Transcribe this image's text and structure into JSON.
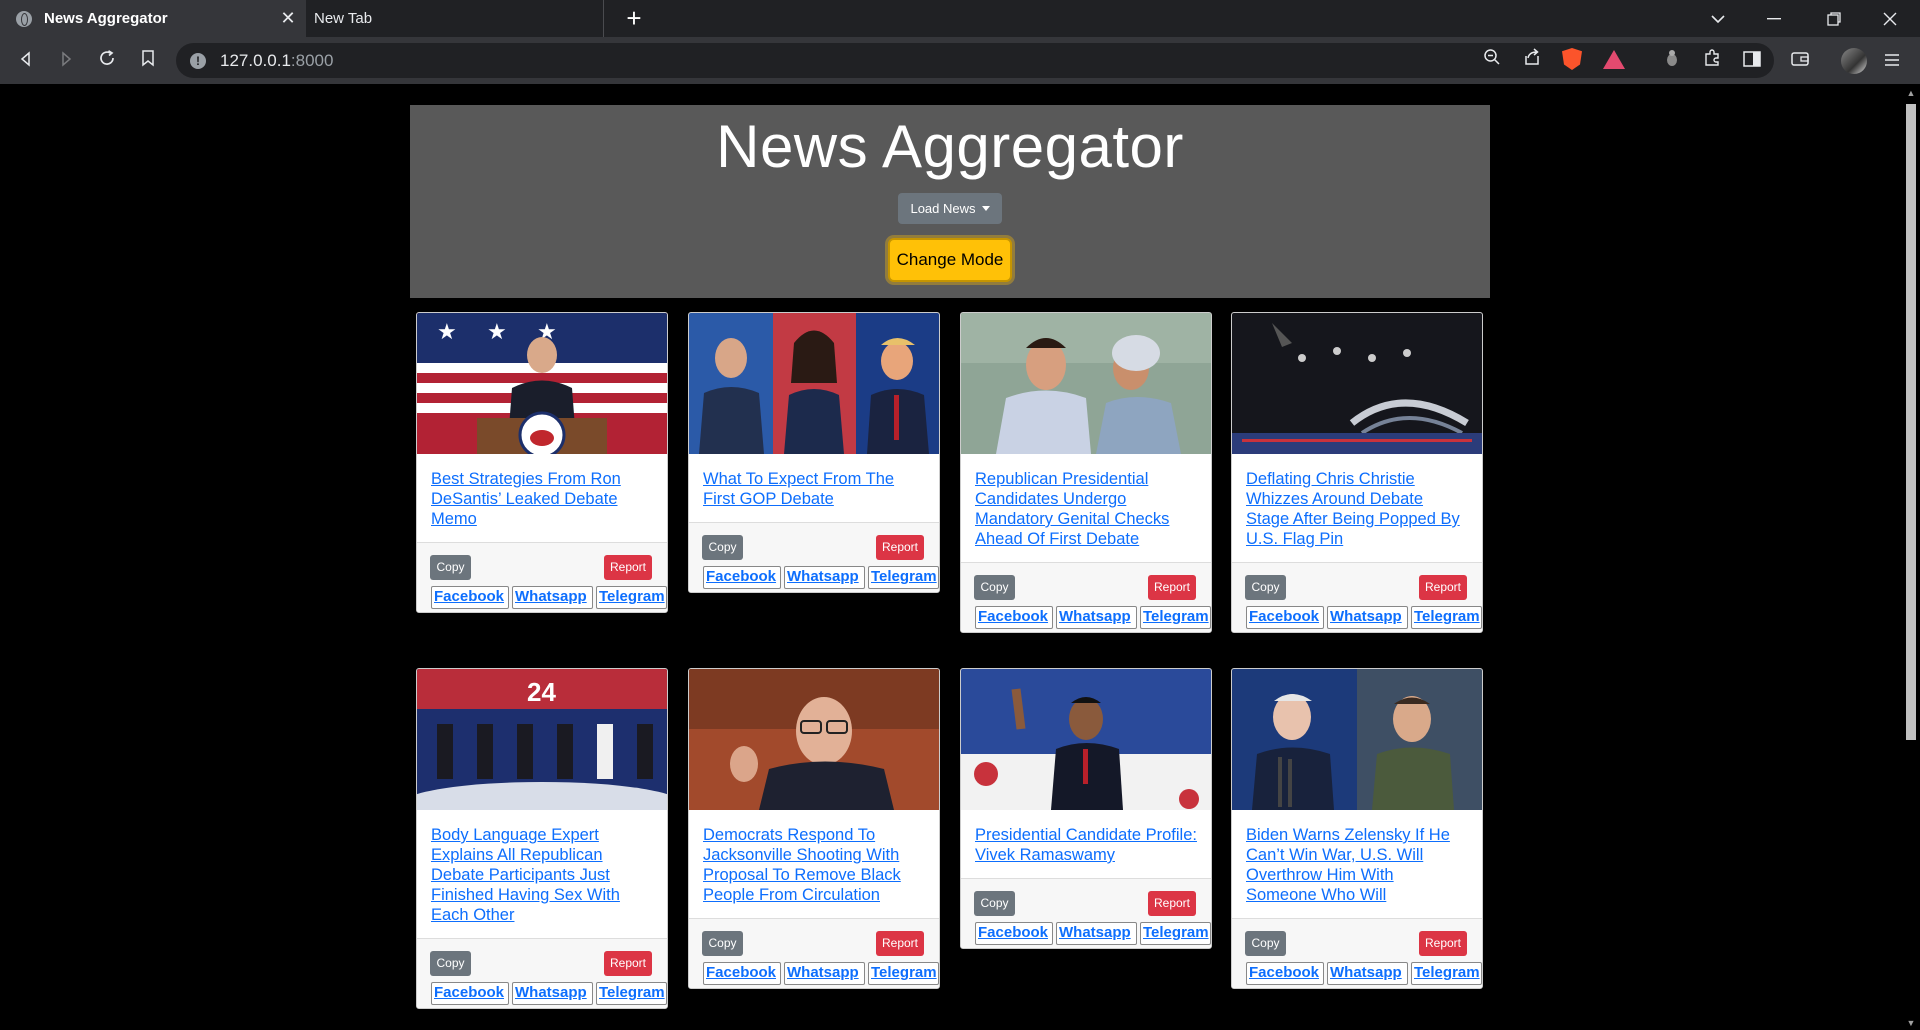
{
  "browser": {
    "tabs": [
      {
        "title": "News Aggregator",
        "active": true
      },
      {
        "title": "New Tab",
        "active": false
      }
    ],
    "url_host": "127.0.0.1",
    "url_port": ":8000",
    "new_tab_symbol": "+",
    "close_symbol": "✕"
  },
  "page": {
    "title": "News Aggregator",
    "load_news_label": "Load News",
    "change_mode_label": "Change Mode"
  },
  "card_labels": {
    "copy": "Copy",
    "report": "Report",
    "facebook": "Facebook",
    "whatsapp": "Whatsapp",
    "telegram": "Telegram"
  },
  "articles": [
    {
      "title": "Best Strategies From Ron DeSantis’ Leaked Debate Memo"
    },
    {
      "title": "What To Expect From The First GOP Debate"
    },
    {
      "title": "Republican Presidential Candidates Undergo Mandatory Genital Checks Ahead Of First Debate"
    },
    {
      "title": "Deflating Chris Christie Whizzes Around Debate Stage After Being Popped By U.S. Flag Pin"
    },
    {
      "title": "Body Language Expert Explains All Republican Debate Participants Just Finished Having Sex With Each Other"
    },
    {
      "title": "Democrats Respond To Jacksonville Shooting With Proposal To Remove Black People From Circulation"
    },
    {
      "title": "Presidential Candidate Profile: Vivek Ramaswamy"
    },
    {
      "title": "Biden Warns Zelensky If He Can’t Win War, U.S. Will Overthrow Him With Someone Who Will"
    }
  ],
  "theme": {
    "header_bg": "#595959",
    "accent_yellow": "#ffc107",
    "link_blue": "#0d6efd",
    "report_red": "#dc3545",
    "copy_gray": "#6c757d"
  }
}
